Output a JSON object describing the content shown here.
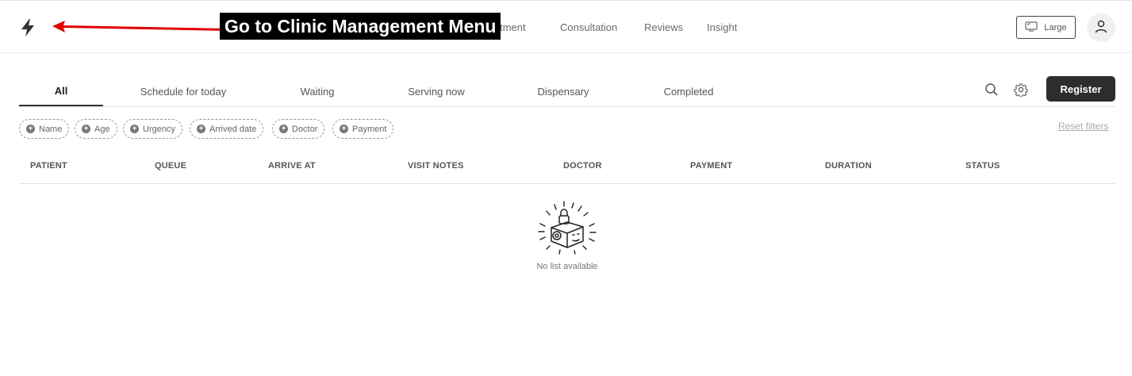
{
  "topbar": {
    "nav": [
      "intment",
      "Consultation",
      "Reviews",
      "Insight"
    ],
    "size_label": "Large"
  },
  "annotation": {
    "label": "Go to Clinic Management Menu",
    "color": "#e00000"
  },
  "tabs": [
    {
      "label": "All",
      "active": true
    },
    {
      "label": "Schedule for today",
      "active": false
    },
    {
      "label": "Waiting",
      "active": false
    },
    {
      "label": "Serving now",
      "active": false
    },
    {
      "label": "Dispensary",
      "active": false
    },
    {
      "label": "Completed",
      "active": false
    }
  ],
  "actions": {
    "search_icon": "search-icon",
    "settings_icon": "gear-icon",
    "register_label": "Register"
  },
  "filters": [
    "Name",
    "Age",
    "Urgency",
    "Arrived date",
    "Doctor",
    "Payment"
  ],
  "reset_label": "Reset filters",
  "table": {
    "columns": [
      "PATIENT",
      "QUEUE",
      "ARRIVE AT",
      "VISIT NOTES",
      "DOCTOR",
      "PAYMENT",
      "DURATION",
      "STATUS"
    ],
    "empty_text": "No list available"
  }
}
